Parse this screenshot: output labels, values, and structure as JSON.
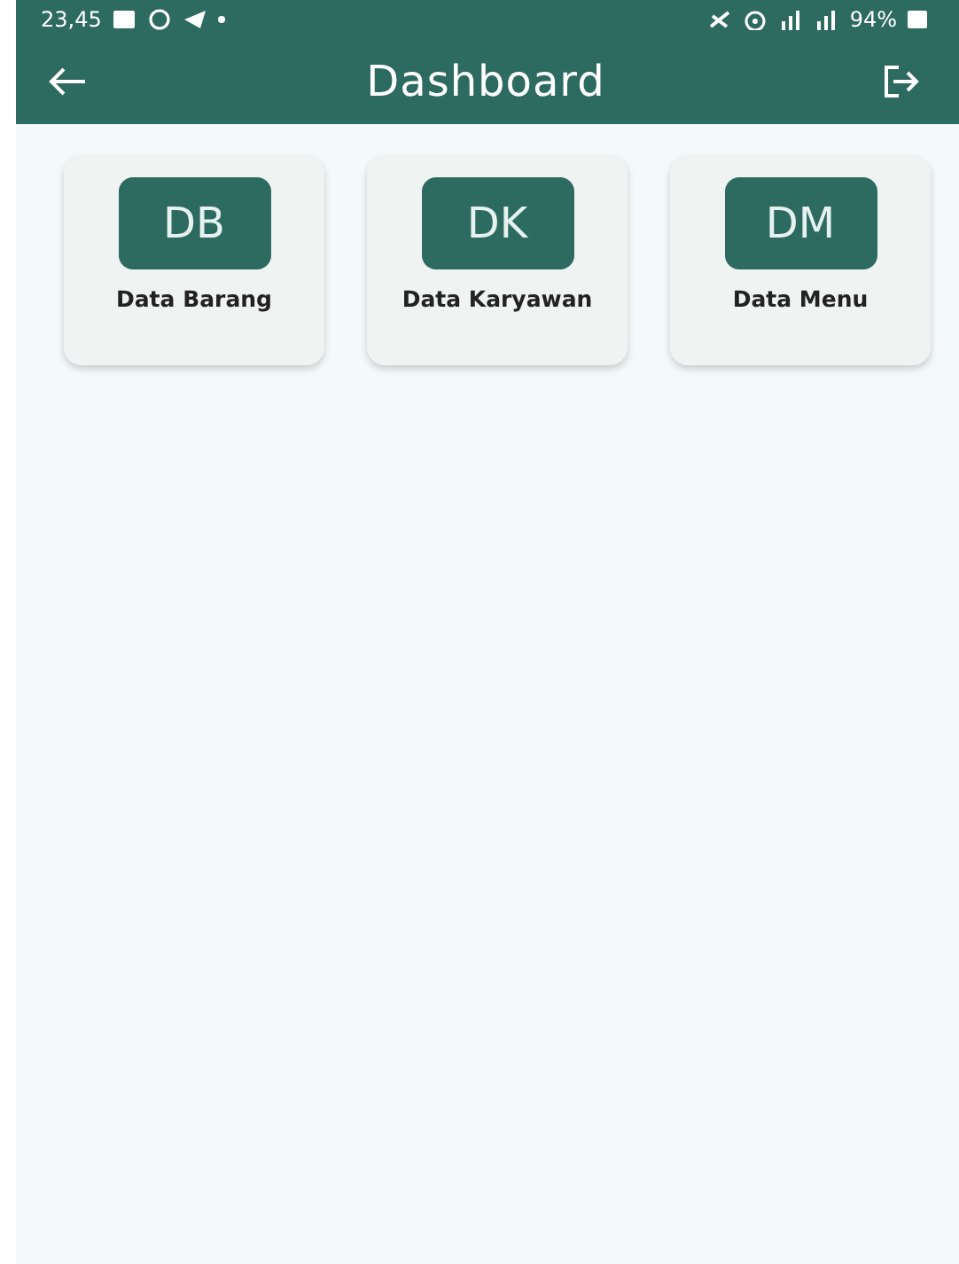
{
  "status_bar": {
    "time": "23,45",
    "battery": "94%"
  },
  "app_bar": {
    "title": "Dashboard"
  },
  "menu_cards": [
    {
      "initials": "DB",
      "label": "Data Barang"
    },
    {
      "initials": "DK",
      "label": "Data Karyawan"
    },
    {
      "initials": "DM",
      "label": "Data Menu"
    }
  ]
}
